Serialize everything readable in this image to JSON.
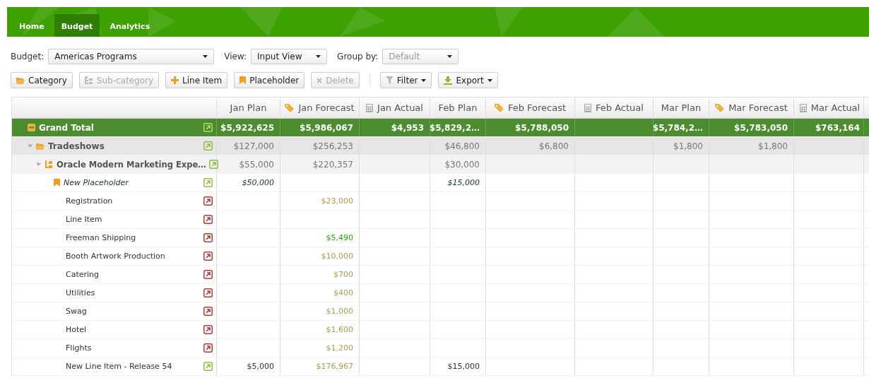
{
  "nav": {
    "tabs": [
      {
        "label": "Home",
        "selected": false
      },
      {
        "label": "Budget",
        "selected": true
      },
      {
        "label": "Analytics",
        "selected": false
      }
    ]
  },
  "filters": [
    {
      "label": "Budget:",
      "value": "Americas Programs",
      "disabled": false
    },
    {
      "label": "View:",
      "value": "Input View",
      "disabled": false
    },
    {
      "label": "Group by:",
      "value": "Default",
      "disabled": true
    }
  ],
  "toolbar": [
    {
      "kind": "button",
      "label": "Category",
      "disabled": false
    },
    {
      "kind": "button",
      "label": "Sub-category",
      "disabled": true
    },
    {
      "kind": "button",
      "label": "Line Item",
      "disabled": false
    },
    {
      "kind": "button",
      "label": "Placeholder",
      "disabled": false
    },
    {
      "kind": "button",
      "label": "Delete",
      "disabled": true
    },
    {
      "kind": "separator"
    },
    {
      "kind": "menu",
      "label": "Filter",
      "disabled": false
    },
    {
      "kind": "menu",
      "label": "Export",
      "disabled": false
    }
  ],
  "grid": {
    "columns": [
      {
        "label": "Jan Plan"
      },
      {
        "label": "Jan Forecast"
      },
      {
        "label": "Jan Actual"
      },
      {
        "label": "Feb Plan"
      },
      {
        "label": "Feb Forecast"
      },
      {
        "label": "Feb Actual"
      },
      {
        "label": "Mar Plan"
      },
      {
        "label": "Mar Forecast"
      },
      {
        "label": "Mar Actual"
      }
    ],
    "rows": [
      {
        "kind": "total",
        "label": "Grand Total",
        "expanded": true,
        "link": {
          "color": "#b6d86a"
        },
        "cells": [
          "$5,922,625",
          "$5,986,067",
          "$4,953",
          "$5,829,2…",
          "$5,788,050",
          null,
          "$5,784,2…",
          "$5,783,050",
          "$763,164"
        ]
      },
      {
        "kind": "category",
        "label": "Tradeshows",
        "expanded": true,
        "link": {
          "color": "#8fbf3a"
        },
        "cells": [
          "$127,000",
          "$256,253",
          null,
          "$46,800",
          "$6,800",
          null,
          "$1,800",
          "$1,800",
          null
        ]
      },
      {
        "kind": "subcategory",
        "label": "Oracle Modern Marketing Expe…",
        "expanded": true,
        "link": {
          "color": "#8fbf3a"
        },
        "cells": [
          "$55,000",
          "$220,357",
          null,
          "$30,000",
          null,
          null,
          null,
          null,
          null
        ]
      },
      {
        "kind": "placeholder",
        "label": "New Placeholder",
        "link": {
          "color": "#8fbf3a"
        },
        "cells": [
          "$50,000",
          null,
          null,
          "$15,000",
          null,
          null,
          null,
          null,
          null
        ]
      },
      {
        "kind": "item",
        "label": "Registration",
        "link": {
          "color": "#b03a3a"
        },
        "cells": [
          null,
          {
            "text": "$23,000",
            "color": "#a3a052"
          },
          null,
          null,
          null,
          null,
          null,
          null,
          null
        ]
      },
      {
        "kind": "item",
        "label": "Line Item",
        "link": {
          "color": "#b03a3a"
        },
        "cells": [
          null,
          null,
          null,
          null,
          null,
          null,
          null,
          null,
          null
        ]
      },
      {
        "kind": "item",
        "label": "Freeman Shipping",
        "link": {
          "color": "#b03a3a"
        },
        "cells": [
          null,
          {
            "text": "$5,490",
            "color": "#2f9e1e"
          },
          null,
          null,
          null,
          null,
          null,
          null,
          null
        ]
      },
      {
        "kind": "item",
        "label": "Booth Artwork Production",
        "link": {
          "color": "#b03a3a"
        },
        "cells": [
          null,
          {
            "text": "$10,000",
            "color": "#a3a052"
          },
          null,
          null,
          null,
          null,
          null,
          null,
          null
        ]
      },
      {
        "kind": "item",
        "label": "Catering",
        "link": {
          "color": "#b03a3a"
        },
        "cells": [
          null,
          {
            "text": "$700",
            "color": "#a3a052"
          },
          null,
          null,
          null,
          null,
          null,
          null,
          null
        ]
      },
      {
        "kind": "item",
        "label": "Utilities",
        "link": {
          "color": "#b03a3a"
        },
        "cells": [
          null,
          {
            "text": "$400",
            "color": "#a3a052"
          },
          null,
          null,
          null,
          null,
          null,
          null,
          null
        ]
      },
      {
        "kind": "item",
        "label": "Swag",
        "link": {
          "color": "#b03a3a"
        },
        "cells": [
          null,
          {
            "text": "$1,000",
            "color": "#a3a052"
          },
          null,
          null,
          null,
          null,
          null,
          null,
          null
        ]
      },
      {
        "kind": "item",
        "label": "Hotel",
        "link": {
          "color": "#b03a3a"
        },
        "cells": [
          null,
          {
            "text": "$1,600",
            "color": "#a3a052"
          },
          null,
          null,
          null,
          null,
          null,
          null,
          null
        ]
      },
      {
        "kind": "item",
        "label": "Flights",
        "link": {
          "color": "#b03a3a"
        },
        "cells": [
          null,
          {
            "text": "$1,200",
            "color": "#a3a052"
          },
          null,
          null,
          null,
          null,
          null,
          null,
          null
        ]
      },
      {
        "kind": "item",
        "label": "New Line Item - Release 54",
        "link": {
          "color": "#8fbf3a"
        },
        "cells": [
          "$5,000",
          {
            "text": "$176,967",
            "color": "#a3a052"
          },
          null,
          "$15,000",
          null,
          null,
          null,
          null,
          null
        ]
      }
    ]
  }
}
